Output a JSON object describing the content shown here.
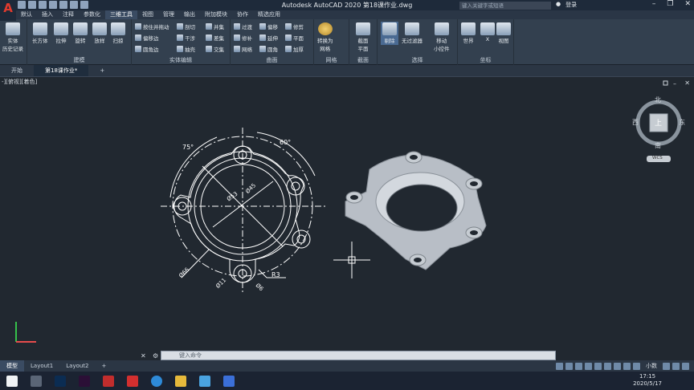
{
  "app": {
    "title": "Autodesk AutoCAD 2020    第18课作业.dwg",
    "search_placeholder": "键入关键字或短语",
    "signin": "登录"
  },
  "ribbon_tabs": [
    "默认",
    "插入",
    "注释",
    "参数化",
    "三维工具",
    "视图",
    "管理",
    "输出",
    "附加模块",
    "协作",
    "精选应用"
  ],
  "active_ribbon_tab": "三维工具",
  "ribbon": {
    "history": "实体\n历史记录",
    "modeling": {
      "title": "建模",
      "buttons": [
        "长方体",
        "拉伸",
        "旋转",
        "放样",
        "扫掠"
      ]
    },
    "solid_edit": {
      "title": "实体编辑",
      "items": [
        "按住并拖动",
        "偏移边",
        "圆角边",
        "剖切",
        "干涉",
        "抽壳",
        "并集",
        "差集",
        "交集"
      ]
    },
    "surface": {
      "title": "曲面",
      "items": [
        "过渡",
        "修补",
        "网络",
        "偏移",
        "延伸",
        "圆角",
        "修剪",
        "平面",
        "加厚"
      ]
    },
    "mesh": {
      "title": "网格",
      "buttons": [
        "转换为\n网格"
      ]
    },
    "section": {
      "title": "截面",
      "buttons": [
        "截面\n平面"
      ]
    },
    "selection": {
      "title": "选择",
      "buttons": [
        "剔除",
        "无过滤器",
        "移动\n小控件"
      ]
    },
    "coords": {
      "title": "坐标",
      "buttons": [
        "世界",
        "X",
        "视图"
      ]
    }
  },
  "doc_tabs": [
    "开始",
    "第18课作业*"
  ],
  "viewport_label": "-][俯视][着色]",
  "viewcube": {
    "north": "北",
    "south": "南",
    "east": "东",
    "west": "西",
    "top": "上",
    "wcs": "WCS"
  },
  "drawing": {
    "angle1": "75°",
    "angle2": "60°",
    "d45": "Ø45",
    "d53": "Ø53",
    "d66": "Ø66",
    "d11": "Ø11",
    "d6": "Ø6",
    "r3": "R3"
  },
  "command_placeholder": "键入命令",
  "layout_tabs": [
    "模型",
    "Layout1",
    "Layout2"
  ],
  "status": {
    "units": "小数"
  },
  "clock": {
    "time": "17:15",
    "date": "2020/5/17"
  }
}
